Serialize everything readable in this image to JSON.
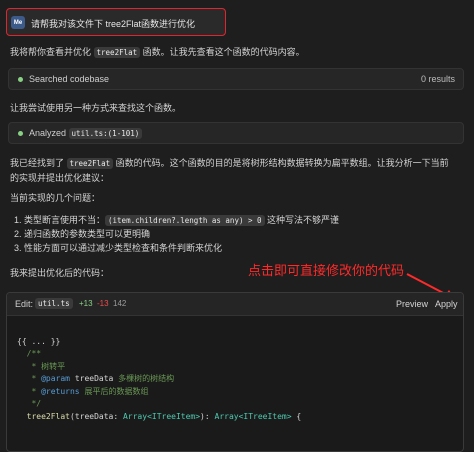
{
  "user_message": {
    "avatar": "Me",
    "text": "请帮我对该文件下 tree2Flat函数进行优化"
  },
  "intro": {
    "pre": "我将帮你查看并优化 ",
    "code": "tree2Flat",
    "post": " 函数。让我先查看这个函数的代码内容。"
  },
  "tool1": {
    "label": "Searched codebase",
    "right": "0 results"
  },
  "retry": "让我尝试使用另一种方式来查找这个函数。",
  "tool2": {
    "label": "Analyzed",
    "code": "util.ts:(1-101)"
  },
  "found": {
    "line1_pre": "我已经找到了 ",
    "line1_code": "tree2Flat",
    "line1_post": " 函数的代码。这个函数的目的是将树形结构数据转换为扁平数组。让我分析一下当前",
    "line2": "的实现并提出优化建议："
  },
  "issues_title": "当前实现的几个问题：",
  "issues": {
    "i1_pre": "1.  类型断言使用不当：",
    "i1_code": "(item.children?.length as any) > 0",
    "i1_post": " 这种写法不够严谨",
    "i2": "2.  递归函数的参数类型可以更明确",
    "i3": "3.  性能方面可以通过减少类型检查和条件判断来优化"
  },
  "proposal": "我来提出优化后的代码：",
  "annotation": "点击即可直接修改你的代码",
  "annotation_color": "#ff2a2a",
  "editor": {
    "edit_label": "Edit:",
    "file": "util.ts",
    "added": "+13",
    "removed": "-13",
    "count": "142",
    "preview_label": "Preview",
    "apply_label": "Apply",
    "code": {
      "l1": "{{ ... }}",
      "l2": "  /**",
      "l3": "   * 树转平",
      "l4_tag": "@param",
      "l4_name": "treeData",
      "l4_desc": " 多棵树的树结构",
      "l5_tag": "@returns",
      "l5_desc": " 展平后的数据数组",
      "l6": "   */",
      "l7_fn": "tree2Flat",
      "l7_param": "(treeData: ",
      "l7_type": "Array<ITreeItem>",
      "l7_ret": "): ",
      "l7_ret_type": "Array<ITreeItem>",
      "l7_end": " {"
    }
  }
}
